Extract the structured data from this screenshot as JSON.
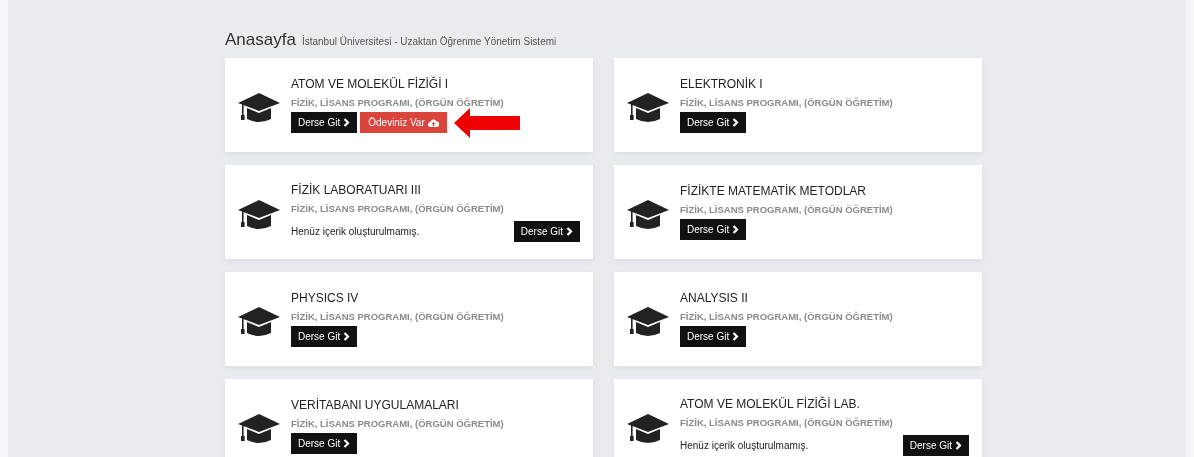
{
  "header": {
    "title": "Anasayfa",
    "subtitle": "İstanbul Üniversitesi - Uzaktan Öğrenme Yönetim Sistemi"
  },
  "courses": [
    {
      "title": "ATOM VE MOLEKÜL FİZİĞİ I",
      "program": "FİZİK, LİSANS PROGRAMI, (ÖRGÜN ÖĞRETİM)",
      "buttons": [
        {
          "label": "Derse Git",
          "kind": "go",
          "highlighted": false
        },
        {
          "label": "Ödeviniz Var",
          "kind": "homework",
          "highlighted": true
        }
      ]
    },
    {
      "title": "ELEKTRONİK I",
      "program": "FİZİK, LİSANS PROGRAMI, (ÖRGÜN ÖĞRETİM)",
      "buttons": [
        {
          "label": "Derse Git",
          "kind": "go",
          "highlighted": false
        }
      ]
    },
    {
      "title": "FİZİK LABORATUARI III",
      "program": "FİZİK, LİSANS PROGRAMI, (ÖRGÜN ÖĞRETİM)",
      "note": "Henüz içerik oluşturulmamış.",
      "buttons": [
        {
          "label": "Derse Git",
          "kind": "go",
          "highlighted": false
        }
      ]
    },
    {
      "title": "FİZİKTE MATEMATİK METODLAR",
      "program": "FİZİK, LİSANS PROGRAMI, (ÖRGÜN ÖĞRETİM)",
      "buttons": [
        {
          "label": "Derse Git",
          "kind": "go",
          "highlighted": false
        }
      ]
    },
    {
      "title": "PHYSICS IV",
      "program": "FİZİK, LİSANS PROGRAMI, (ÖRGÜN ÖĞRETİM)",
      "buttons": [
        {
          "label": "Derse Git",
          "kind": "go",
          "highlighted": false
        }
      ]
    },
    {
      "title": "ANALYSIS II",
      "program": "FİZİK, LİSANS PROGRAMI, (ÖRGÜN ÖĞRETİM)",
      "buttons": [
        {
          "label": "Derse Git",
          "kind": "go",
          "highlighted": false
        }
      ]
    },
    {
      "title": "VERİTABANI UYGULAMALARI",
      "program": "FİZİK, LİSANS PROGRAMI, (ÖRGÜN ÖĞRETİM)",
      "buttons": [
        {
          "label": "Derse Git",
          "kind": "go",
          "highlighted": false
        }
      ]
    },
    {
      "title": "ATOM VE MOLEKÜL FİZİĞİ LAB.",
      "program": "FİZİK, LİSANS PROGRAMI, (ÖRGÜN ÖĞRETİM)",
      "note": "Henüz içerik oluşturulmamış.",
      "buttons": [
        {
          "label": "Derse Git",
          "kind": "go",
          "highlighted": false
        }
      ]
    }
  ]
}
